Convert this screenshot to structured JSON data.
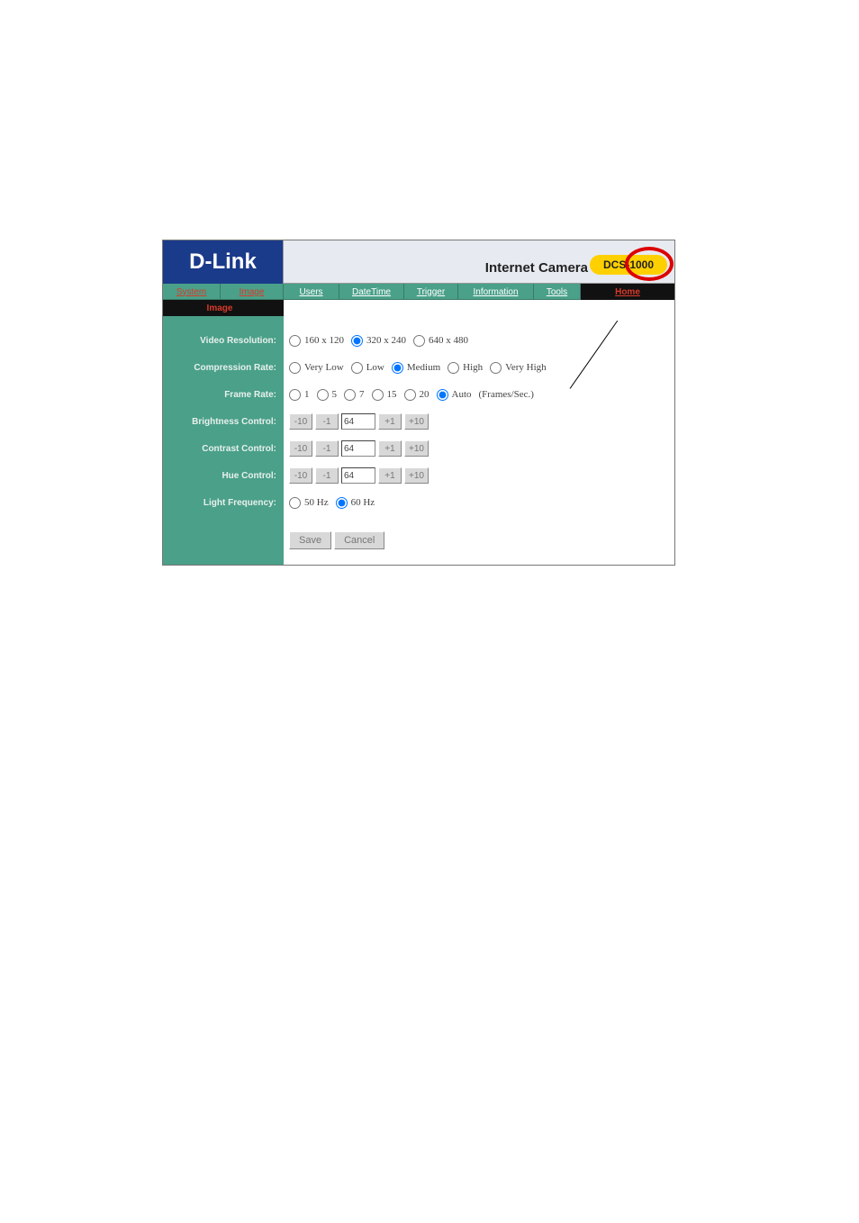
{
  "header": {
    "brand": "D-Link",
    "product_title": "Internet Camera",
    "model": "DCS-1000"
  },
  "nav": {
    "items": [
      {
        "label": "System",
        "key": "system"
      },
      {
        "label": "Image",
        "key": "image"
      },
      {
        "label": "Users",
        "key": "users"
      },
      {
        "label": "DateTime",
        "key": "datetime"
      },
      {
        "label": "Trigger",
        "key": "trigger"
      },
      {
        "label": "Information",
        "key": "information"
      },
      {
        "label": "Tools",
        "key": "tools"
      },
      {
        "label": "Home",
        "key": "home"
      }
    ]
  },
  "sidebar": {
    "active_section": "Image"
  },
  "form": {
    "video_resolution": {
      "label": "Video Resolution:",
      "options": [
        {
          "label": "160 x 120",
          "selected": false
        },
        {
          "label": "320 x 240",
          "selected": true
        },
        {
          "label": "640 x 480",
          "selected": false
        }
      ]
    },
    "compression_rate": {
      "label": "Compression Rate:",
      "options": [
        {
          "label": "Very Low",
          "selected": false
        },
        {
          "label": "Low",
          "selected": false
        },
        {
          "label": "Medium",
          "selected": true
        },
        {
          "label": "High",
          "selected": false
        },
        {
          "label": "Very High",
          "selected": false
        }
      ]
    },
    "frame_rate": {
      "label": "Frame Rate:",
      "options": [
        {
          "label": "1",
          "selected": false
        },
        {
          "label": "5",
          "selected": false
        },
        {
          "label": "7",
          "selected": false
        },
        {
          "label": "15",
          "selected": false
        },
        {
          "label": "20",
          "selected": false
        },
        {
          "label": "Auto",
          "selected": true
        }
      ],
      "unit_suffix": "(Frames/Sec.)"
    },
    "brightness": {
      "label": "Brightness Control:",
      "value": "64",
      "buttons": {
        "minus10": "-10",
        "minus1": "-1",
        "plus1": "+1",
        "plus10": "+10"
      }
    },
    "contrast": {
      "label": "Contrast Control:",
      "value": "64",
      "buttons": {
        "minus10": "-10",
        "minus1": "-1",
        "plus1": "+1",
        "plus10": "+10"
      }
    },
    "hue": {
      "label": "Hue Control:",
      "value": "64",
      "buttons": {
        "minus10": "-10",
        "minus1": "-1",
        "plus1": "+1",
        "plus10": "+10"
      }
    },
    "light_frequency": {
      "label": "Light Frequency:",
      "options": [
        {
          "label": "50 Hz",
          "selected": false
        },
        {
          "label": "60 Hz",
          "selected": true
        }
      ]
    },
    "actions": {
      "save": "Save",
      "cancel": "Cancel"
    }
  }
}
